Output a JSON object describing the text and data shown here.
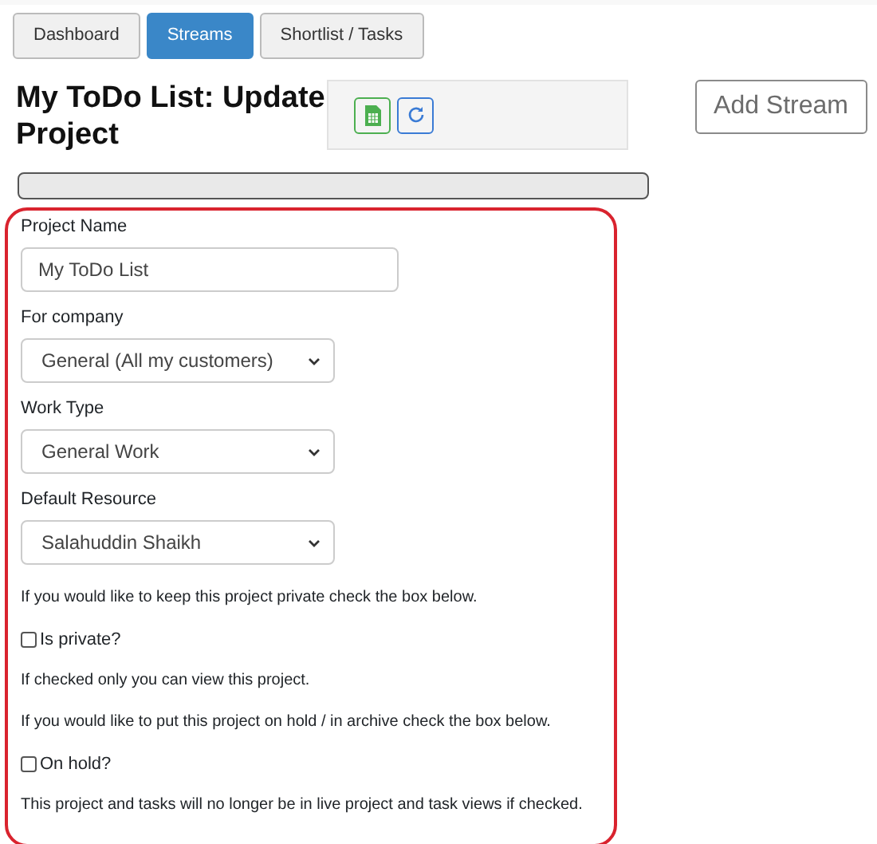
{
  "tabs": [
    {
      "label": "Dashboard",
      "selected": false
    },
    {
      "label": "Streams",
      "selected": true
    },
    {
      "label": "Shortlist / Tasks",
      "selected": false
    }
  ],
  "title": "My ToDo List: Update Project",
  "add_button": "Add Stream",
  "progress": {
    "level": 0
  },
  "fields": [
    {
      "kind": "text",
      "label": "Project Name",
      "value": "My ToDo List"
    },
    {
      "kind": "select",
      "label": "For company",
      "value": "General (All my customers)"
    },
    {
      "kind": "select",
      "label": "Work Type",
      "value": "General Work"
    },
    {
      "kind": "select",
      "label": "Default Resource",
      "value": "Salahuddin Shaikh"
    }
  ],
  "items": [
    {
      "kind": "note",
      "text": "If you would like to keep this project private check the box below."
    },
    {
      "kind": "checkbox",
      "label": "Is private?",
      "checked": false
    },
    {
      "kind": "note",
      "text": "If checked only you can view this project."
    },
    {
      "kind": "note",
      "text": "If you would like to put this project on hold / in archive check the box below."
    },
    {
      "kind": "checkbox",
      "label": "On hold?",
      "checked": false
    },
    {
      "kind": "note",
      "text": "This project and tasks will no longer be in live project and task views if checked."
    }
  ]
}
